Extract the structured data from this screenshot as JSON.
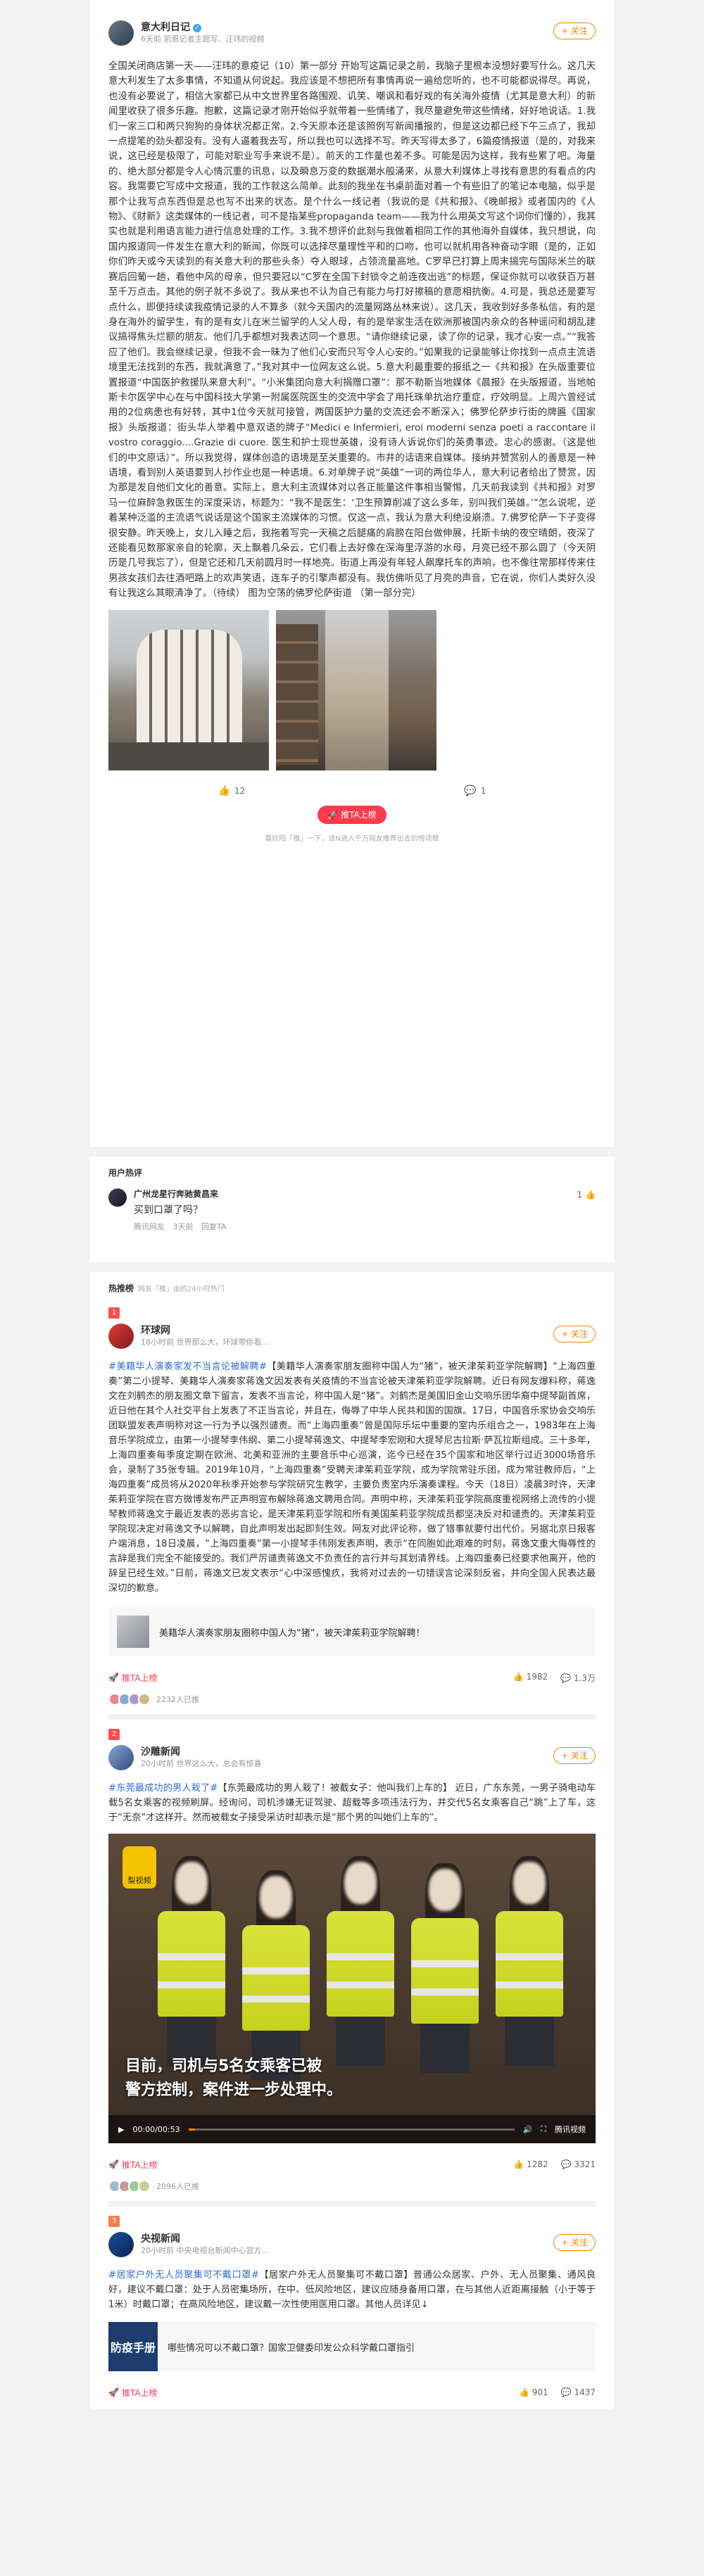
{
  "post": {
    "author": "意大利日记",
    "verified_mark": "✓",
    "meta": "6天前 凯恩记者主题写、汪玮的视频",
    "follow_label": "+ 关注",
    "text": "全国关闭商店第一天——汪玮的意疫记（10）第一部分 开始写这篇记录之前，我脑子里根本没想好要写什么。这几天意大利发生了太多事情，不知道从何说起。我应该是不想把所有事情再说一遍给您听的，也不可能都说得尽。再说，也没有必要说了，相信大家都已从中文世界里各路围观、讥笑、嘲讽和看好戏的有关海外疫情（尤其是意大利）的新闻里收获了很多乐趣。抱歉，这篇记录才刚开始似乎就带着一些情绪了，我尽量避免带这些情绪，好好地说话。1.我们一家三口和两只狗狗的身体状况都正常。2.今天原本还是该照例写新闻播报的，但是这边都已经下午三点了，我却一点提笔的劲头都没有。没有人逼着我去写，所以我也可以选择不写。昨天写得太多了，6篇疫情报道（是的，对我来说，这已经是极限了，可能对职业写手来说不是）。前天的工作量也差不多。可能是因为这样，我有些累了吧。海量的、绝大部分都是令人心情沉重的讯息，以及瞬息万变的数据潮水般涌来，从意大利媒体上寻找有意思的有看点的内容。我需要它写成中文报道，我的工作就这么简单。此刻的我坐在书桌前面对着一个有些旧了的笔记本电脑，似乎是那个让我写点东西但是总也写不出来的状态。是个什么一线记者（我说的是《共和报》、《晚邮报》或者国内的《人物》、《财新》这类媒体的一线记者，可不是指某些propaganda team——我为什么用英文写这个词你们懂的），我其实也就是利用语言能力进行信息处理的工作。3.我不想评价此刻与我做着相同工作的其他海外自媒体，我只想说，向国内报道同一件发生在意大利的新闻，你既可以选择尽量理性平和的口吻，也可以就机用各种奋动字眼（是的，正如你们昨天或今天读到的有关意大利的那些头条）夺人眼球，占领流量高地。C罗早已打算上周末搞完与国际米兰的联赛后回葡一趟，看他中风的母亲，但只要冠以“C罗在全国下封锁令之前连夜出逃”的标题，保证你就可以收获百万甚至千万点击。其他的例子就不多说了。我从来也不认为自己有能力与打好擦稿的意愿相抗衡。4.可是，我总还是要写点什么，即便持续读我疫情记录的人不算多（就今天国内的流量网路丛林来说）。这几天，我收到好多条私信，有的是身在海外的留学生，有的是有女儿在米兰留学的人父人母，有的是举家生活在欧洲那被国内亲众的各种谣问和胡乱建议搞得焦头烂额的朋友。他们几乎都想对我表达同一个意思。“请你继续记录，读了你的记录，我才心安一点。”“我答应了他们。我会继续记录，但我不会一昧为了他们心安而只写令人心安的。”如果我的记录能够让你找到一点点主流语境里无法找到的东西，我就满意了。”我对其中一位网友这么说。5.意大利最重要的报纸之一《共和报》在头版重要位置报道“中国医护救援队来意大利”。“小米集团向意大利捐赠口罩”：那不勒斯当地媒体《晨报》在头版报道，当地帕斯卡尔医学中心在与中国科技大学第一附属医院医生的交流中学会了用托珠单抗治疗重症，疗效明显。上周六曾经试用的2位病患也有好转，其中1位今天就可接管，两国医护力量的交流还会不断深入；佛罗伦萨步行街的牌匾《国家报》头版报道：街头华人举着中意双语的牌子“Medici e Infermieri, eroi moderni senza poeti a raccontare il vostro coraggio....Grazie di cuore. 医生和护士现世英雄，没有诗人诉说你们的英勇事迹。忠心的感谢。（这是他们的中文原话）”。所以我觉得，媒体创造的语境是至关重要的。市井的话语来自媒体。接纳并赞赏别人的善意是一种语境，看到别人英语要到人抄作业也是一种语境。6.对单牌子说“英雄”一词的两位华人，意大利记者给出了赞赏，因为那是发自他们文化的善意。实际上，意大利主流媒体对以各正能量这件事相当警惕，几天前我读到《共和报》对罗马一位麻醉急救医生的深度采访，标题为：“我不是医生：‘卫生预算削减了这么多年，别叫我们英雄。’”怎么说呢，逆着某种泛滥的主流语气说话是这个国家主流媒体的习惯。仅这一点，我认为意大利绝没崩溃。7.佛罗伦萨一下子变得很安静。昨天晚上，女儿入睡之后，我拖着写完一天稿之后腿痛的肩膀在阳台做伸展，托斯卡纳的夜空晴朗，夜深了还能看见数那家亲自的轮廓，天上飘着几朵云，它们看上去好像在深海里浮游的水母，月亮已经不那么圆了（今天阴历是几号我忘了），但是它还和几天前圆月时一样地亮。街道上再没有年轻人飙摩托车的声响，也不像往常那样传来住男孩女孩们去往酒吧路上的欢声笑语，连车子的引擎声都没有。我仿佛听见了月亮的声音，它在说，你们人类好久没有让我这么其眼清净了。（待续） 图为空荡的佛罗伦萨街道 （第一部分完）",
    "like_count": "12",
    "comment_count": "1",
    "boost_label": "推TA上榜",
    "boost_note": "嘉欣阳「推」一下，该N进入千万网友推荐出去的榜项框"
  },
  "comments": {
    "title": "用户热评",
    "items": [
      {
        "name": "广州龙星行奔驰黄昌来",
        "text": "买到口罩了吗？",
        "source": "腾讯网友",
        "time": "3天前",
        "action": "回复TA",
        "likes": "1"
      }
    ]
  },
  "hot": {
    "title": "热推榜",
    "subtitle": "网友「推」出的24小时热门",
    "items": [
      {
        "rank": "1",
        "author": "环球网",
        "meta": "18小时前 世界那么大，环球带你看…",
        "follow_label": "+ 关注",
        "hashtag": "#美籍华人演奏家发不当言论被解聘#",
        "text": "【美籍华人演奏家朋友圈称中国人为“猪”，被天津茱莉亚学院解聘】“上海四重奏”第二小提琴、美籍华人演奏家蒋逸文因发表有关疫情的不当言论被天津茱莉亚学院解聘。近日有网友爆料称，蒋逸文在刘鹤杰的朋友圈文章下留言，发表不当言论，称中国人是“猪”。刘鹤杰是美国旧金山交响乐团华裔中提琴副首席，近日他在其个人社交平台上发表了不正当言论，并且在，侮辱了中华人民共和国的国旗。17日，中国音乐家协会交响乐团联盟发表声明称对这一行为予以强烈谴责。而“上海四重奏”曾是国际乐坛中重要的室内乐组合之一，1983年在上海音乐学院成立，由第一小提琴李伟纲、第二小提琴蒋逸文、中提琴李宏刚和大提琴尼古拉斯·萨瓦拉斯组成。三十多年，上海四重奏每季度定期在欧洲、北美和亚洲的主要音乐中心巡演，迄今已经在35个国家和地区举行过近3000场音乐会，录制了35张专辑。2019年10月，“上海四重奏”受聘天津茱莉亚学院，成为学院常驻乐团，成为常驻教师后，“上海四重奏”成员将从2020年秋季开始参与学院研究生教学，主要负责室内乐演奏课程。今天（18日）凌晨3时许，天津茱莉亚学院在官方微博发布严正声明宣布解除蒋逸文聘用合同。声明中称，天津茱莉亚学院高度重视网络上流传的小提琴教师蒋逸文于最近发表的恶劣言论，是天津茱莉亚学院和所有美国茱莉亚学院成员都坚决反对和谴责的。天津茱莉亚学院现决定对蒋逸文予以解聘，自此声明发出起即刻生效。网友对此评论称，做了错事就要付出代价。另据北京日报客户端消息，18日凌晨，“上海四重奏”第一小提琴手伟刚发表声明，表示“在同胞如此艰难的时刻，蒋逸文重大侮辱性的言辞是我们完全不能接受的。我们严厉谴责蒋逸文不负责任的言行并与其划清界线。上海四重奏已经要求他离开，他的辞呈已经生效。”日前，蒋逸文已发文表示“心中深感愧疚，我将对过去的一切错误言论深刻反省，并向全国人民表达最深切的歉意。",
        "quote": "美籍华人演奏家朋友圈称中国人为“猪”，被天津茱莉亚学院解聘！",
        "boost_label": "推TA上榜",
        "likes": "1982",
        "comments": "1.3万",
        "readers_label": "2232人已推"
      },
      {
        "rank": "2",
        "author": "沙雕新闻",
        "meta": "20小时前 世界这么大，总会有惊喜",
        "follow_label": "+ 关注",
        "hashtag": "#东莞最成功的男人栽了#",
        "text": "【东莞最成功的男人栽了！被截女子：他叫我们上车的】 近日，广东东莞，一男子骑电动车载5名女乘客的视频刷屏。经询问，司机涉嫌无证驾驶、超载等多项违法行为，并交代5名女乘客自己“跳”上了车，这于“无奈”才这样开。然而被载女子接受采访时却表示是“那个男的叫她们上车的”。",
        "video_logo": "梨视频",
        "video_caption_1": "目前，司机与5名女乘客已被",
        "video_caption_2": "警方控制，案件进一步处理中。",
        "video_time": "00:00/00:53",
        "video_progress": 0.02,
        "video_brand": "腾讯视频",
        "boost_label": "推TA上榜",
        "likes": "1282",
        "comments": "3321",
        "readers_label": "2096人已推"
      },
      {
        "rank": "3",
        "author": "央视新闻",
        "meta": "20小时前 中央电视台新闻中心官方…",
        "follow_label": "+ 关注",
        "hashtag": "#居家户外无人员聚集可不戴口罩#",
        "text": "【居家户外无人员聚集可不戴口罩】普通公众居家、户外、无人员聚集、通风良好，建议不戴口罩：处于人员密集场所，在中、低风险地区，建议应随身备用口罩，在与其他人近距离接触（小于等于1米）时戴口罩；在高风险地区，建议戴一次性使用医用口罩。其他人员详见↓",
        "quote": "哪些情况可以不戴口罩？国家卫健委印发公众科学戴口罩指引",
        "banner_text": "防疫手册",
        "boost_label": "推TA上榜",
        "likes": "901",
        "comments": "1437"
      }
    ]
  }
}
